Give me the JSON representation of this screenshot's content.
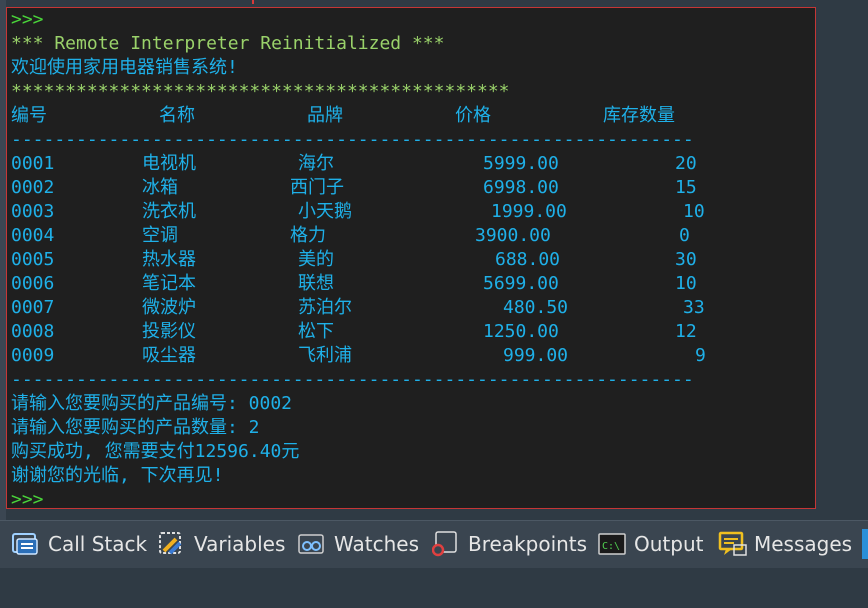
{
  "console": {
    "prompt_top": ">>>",
    "reinit_message": "*** Remote Interpreter Reinitialized ***",
    "welcome": "欢迎使用家用电器销售系统!",
    "stars": "**********************************************",
    "headers": [
      "编号",
      "名称",
      "品牌",
      "价格",
      "库存数量"
    ],
    "dashes": "---------------------------------------------------------------",
    "rows": [
      [
        "0001",
        "电视机",
        "海尔",
        "5999.00",
        "20"
      ],
      [
        "0002",
        "冰箱",
        "西门子",
        "6998.00",
        "15"
      ],
      [
        "0003",
        "洗衣机",
        "小天鹅",
        "1999.00",
        "10"
      ],
      [
        "0004",
        "空调",
        "格力",
        "3900.00",
        "0"
      ],
      [
        "0005",
        "热水器",
        "美的",
        "688.00",
        "30"
      ],
      [
        "0006",
        "笔记本",
        "联想",
        "5699.00",
        "10"
      ],
      [
        "0007",
        "微波炉",
        "苏泊尔",
        "480.50",
        "33"
      ],
      [
        "0008",
        "投影仪",
        "松下",
        "1250.00",
        "12"
      ],
      [
        "0009",
        "吸尘器",
        "飞利浦",
        "999.00",
        "9"
      ]
    ],
    "dashes_bottom": "---------------------------------------------------------------",
    "input_product_id": "请输入您要购买的产品编号: 0002",
    "input_quantity": "请输入您要购买的产品数量: 2",
    "purchase_result": "购买成功, 您需要支付12596.40元",
    "thanks": "谢谢您的光临, 下次再见!",
    "prompt_bottom": ">>>"
  },
  "tabs": [
    {
      "label": "Call Stack",
      "icon": "call-stack-icon"
    },
    {
      "label": "Variables",
      "icon": "variables-icon"
    },
    {
      "label": "Watches",
      "icon": "watches-icon"
    },
    {
      "label": "Breakpoints",
      "icon": "breakpoints-icon"
    },
    {
      "label": "Output",
      "icon": "output-icon"
    },
    {
      "label": "Messages",
      "icon": "messages-icon"
    }
  ],
  "colors": {
    "prompt": "#4ad43a",
    "reinit": "#9ad26a",
    "console_text": "#1fb0e8",
    "console_bg": "#1f1f1f",
    "border": "#c53636"
  }
}
